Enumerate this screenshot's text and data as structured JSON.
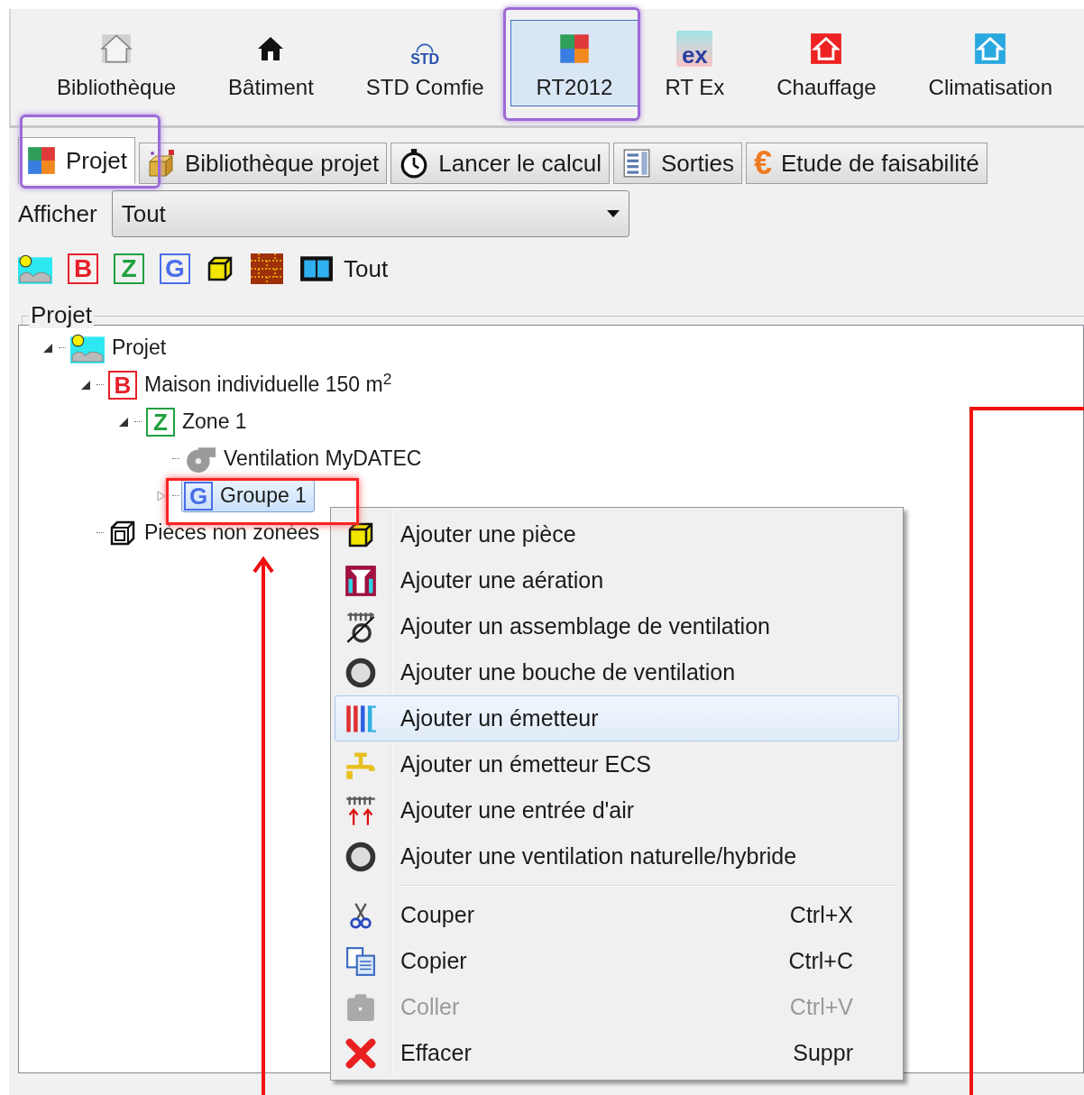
{
  "ribbon": [
    {
      "label": "Bibliothèque",
      "kind": "library",
      "selected": false
    },
    {
      "label": "Bâtiment",
      "kind": "building",
      "selected": false
    },
    {
      "label": "STD Comfie",
      "kind": "std",
      "icon_text": "STD",
      "selected": false
    },
    {
      "label": "RT2012",
      "kind": "rt2012",
      "selected": true
    },
    {
      "label": "RT Ex",
      "kind": "rtex",
      "icon_text": "ex",
      "selected": false
    },
    {
      "label": "Chauffage",
      "kind": "heating",
      "selected": false
    },
    {
      "label": "Climatisation",
      "kind": "cooling",
      "selected": false
    }
  ],
  "tabs": [
    {
      "label": "Projet",
      "kind": "project",
      "selected": true
    },
    {
      "label": "Bibliothèque projet",
      "kind": "library",
      "selected": false
    },
    {
      "label": "Lancer le calcul",
      "kind": "calc",
      "selected": false
    },
    {
      "label": "Sorties",
      "kind": "outputs",
      "selected": false
    },
    {
      "label": "Etude de faisabilité",
      "kind": "feasibility",
      "icon_text": "€",
      "selected": false
    }
  ],
  "display_filter": {
    "label": "Afficher",
    "value": "Tout"
  },
  "filter_icons": [
    {
      "kind": "project"
    },
    {
      "kind": "letter",
      "letter": "B",
      "color": "#e8202a"
    },
    {
      "kind": "letter",
      "letter": "Z",
      "color": "#20a040"
    },
    {
      "kind": "letter",
      "letter": "G",
      "color": "#4a6ee8"
    },
    {
      "kind": "room"
    },
    {
      "kind": "wall"
    },
    {
      "kind": "window"
    }
  ],
  "filter_all_label": "Tout",
  "tree": {
    "title": "Projet",
    "items": [
      {
        "label": "Projet",
        "kind": "project",
        "expanded": true,
        "selected": false,
        "children": [
          {
            "label": "Maison individuelle 150 m$^{2}$",
            "kind": "letter",
            "letter": "B",
            "color": "#e8202a",
            "expanded": true,
            "selected": false,
            "children": [
              {
                "label": "Zone 1",
                "kind": "letter",
                "letter": "Z",
                "color": "#20a040",
                "expanded": true,
                "selected": false,
                "children": [
                  {
                    "label": "Ventilation MyDATEC",
                    "kind": "ventilation",
                    "selected": false
                  },
                  {
                    "label": "Groupe 1",
                    "kind": "letter",
                    "letter": "G",
                    "color": "#4a6ee8",
                    "expanded": false,
                    "selected": true
                  }
                ]
              }
            ]
          },
          {
            "label": "Pièces non zonées",
            "kind": "rooms",
            "selected": false
          }
        ]
      }
    ]
  },
  "context_menu": {
    "groups": [
      [
        {
          "label": "Ajouter une pièce",
          "kind": "room",
          "selected": false,
          "disabled": false
        },
        {
          "label": "Ajouter une aération",
          "kind": "aeration",
          "selected": false,
          "disabled": false
        },
        {
          "label": "Ajouter un assemblage de ventilation",
          "kind": "assembly",
          "selected": false,
          "disabled": false
        },
        {
          "label": "Ajouter une bouche de ventilation",
          "kind": "outlet",
          "selected": false,
          "disabled": false
        },
        {
          "label": "Ajouter un émetteur",
          "kind": "emitter",
          "selected": true,
          "disabled": false
        },
        {
          "label": "Ajouter un émetteur ECS",
          "kind": "tap",
          "selected": false,
          "disabled": false
        },
        {
          "label": "Ajouter une entrée d'air",
          "kind": "inlet",
          "selected": false,
          "disabled": false
        },
        {
          "label": "Ajouter une ventilation naturelle/hybride",
          "kind": "outlet",
          "selected": false,
          "disabled": false
        }
      ],
      [
        {
          "label": "Couper",
          "kind": "cut",
          "shortcut": "Ctrl+X",
          "selected": false,
          "disabled": false
        },
        {
          "label": "Copier",
          "kind": "copy",
          "shortcut": "Ctrl+C",
          "selected": false,
          "disabled": false
        },
        {
          "label": "Coller",
          "kind": "paste",
          "shortcut": "Ctrl+V",
          "selected": false,
          "disabled": true
        },
        {
          "label": "Effacer",
          "kind": "delete",
          "shortcut": "Suppr",
          "selected": false,
          "disabled": false
        }
      ]
    ]
  }
}
